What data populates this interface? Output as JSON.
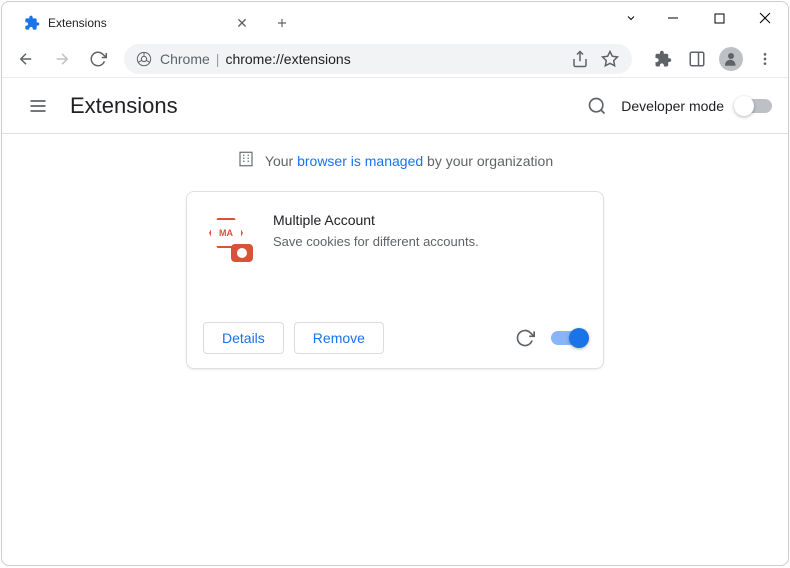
{
  "tab": {
    "title": "Extensions"
  },
  "addressbar": {
    "secure_label": "Chrome",
    "url": "chrome://extensions"
  },
  "header": {
    "title": "Extensions",
    "dev_mode_label": "Developer mode"
  },
  "banner": {
    "prefix": "Your ",
    "link": "browser is managed",
    "suffix": " by your organization"
  },
  "extension": {
    "name": "Multiple Account",
    "description": "Save cookies for different accounts.",
    "badge": "MA",
    "details_label": "Details",
    "remove_label": "Remove",
    "enabled": true
  }
}
